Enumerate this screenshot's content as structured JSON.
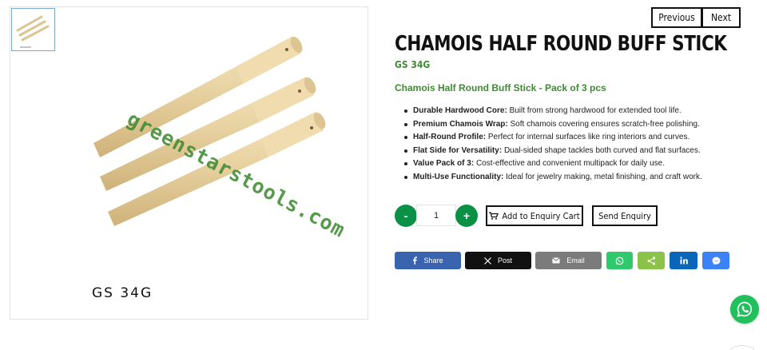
{
  "navigation": {
    "previous_label": "Previous",
    "next_label": "Next"
  },
  "gallery": {
    "thumbnail_icon": "buff-stick-thumbnail",
    "watermark": "greenstarstools.com",
    "image_code": "GS 34G"
  },
  "product": {
    "title": "CHAMOIS HALF ROUND BUFF STICK",
    "sku": "GS 34G",
    "subtitle": "Chamois Half Round Buff Stick - Pack of 3 pcs",
    "features": [
      {
        "label": "Durable Hardwood Core:",
        "text": "Built from strong hardwood for extended tool life."
      },
      {
        "label": "Premium Chamois Wrap:",
        "text": "Soft chamois covering ensures scratch-free polishing."
      },
      {
        "label": "Half-Round Profile:",
        "text": "Perfect for internal surfaces like ring interiors and curves."
      },
      {
        "label": "Flat Side for Versatility:",
        "text": "Dual-sided shape tackles both curved and flat surfaces."
      },
      {
        "label": "Value Pack of 3:",
        "text": "Cost-effective and convenient multipack for daily use."
      },
      {
        "label": "Multi-Use Functionality:",
        "text": "Ideal for jewelry making, metal finishing, and craft work."
      }
    ]
  },
  "quantity": {
    "minus_label": "-",
    "value": "1",
    "plus_label": "+"
  },
  "actions": {
    "enquiry_cart_label": "Add to Enquiry Cart",
    "send_enquiry_label": "Send Enquiry"
  },
  "share": {
    "facebook_label": "Share",
    "x_label": "Post",
    "email_label": "Email"
  },
  "colors": {
    "brand_green": "#0a9146",
    "accent_green": "#3f8b33",
    "whatsapp": "#20c15d"
  }
}
